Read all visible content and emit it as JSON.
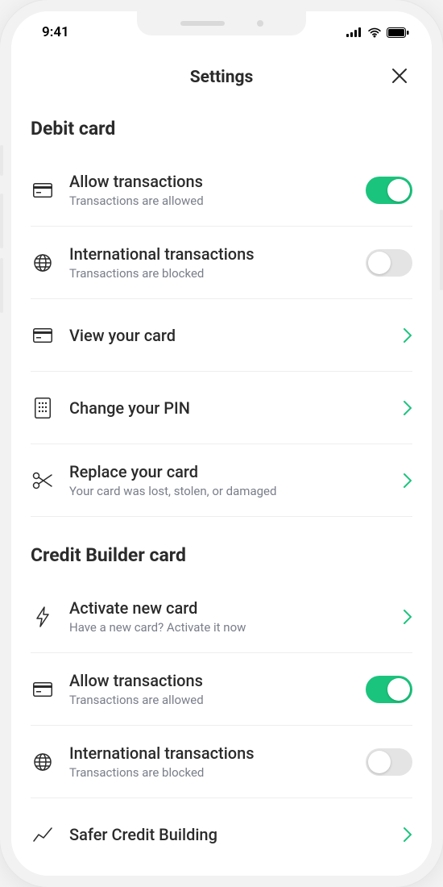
{
  "status": {
    "time": "9:41"
  },
  "header": {
    "title": "Settings"
  },
  "sections": {
    "debit": {
      "title": "Debit card",
      "rows": {
        "allow": {
          "title": "Allow transactions",
          "sub": "Transactions are allowed"
        },
        "intl": {
          "title": "International transactions",
          "sub": "Transactions are blocked"
        },
        "view": {
          "title": "View your card"
        },
        "pin": {
          "title": "Change your PIN"
        },
        "replace": {
          "title": "Replace your card",
          "sub": "Your card was lost, stolen, or damaged"
        }
      }
    },
    "credit": {
      "title": "Credit Builder card",
      "rows": {
        "activate": {
          "title": "Activate new card",
          "sub": "Have a new card? Activate it now"
        },
        "allow": {
          "title": "Allow transactions",
          "sub": "Transactions are allowed"
        },
        "intl": {
          "title": "International transactions",
          "sub": "Transactions are blocked"
        },
        "safer": {
          "title": "Safer Credit Building"
        }
      }
    }
  },
  "colors": {
    "accent": "#1bc47d"
  },
  "toggles": {
    "debit_allow": true,
    "debit_intl": false,
    "credit_allow": true,
    "credit_intl": false
  }
}
